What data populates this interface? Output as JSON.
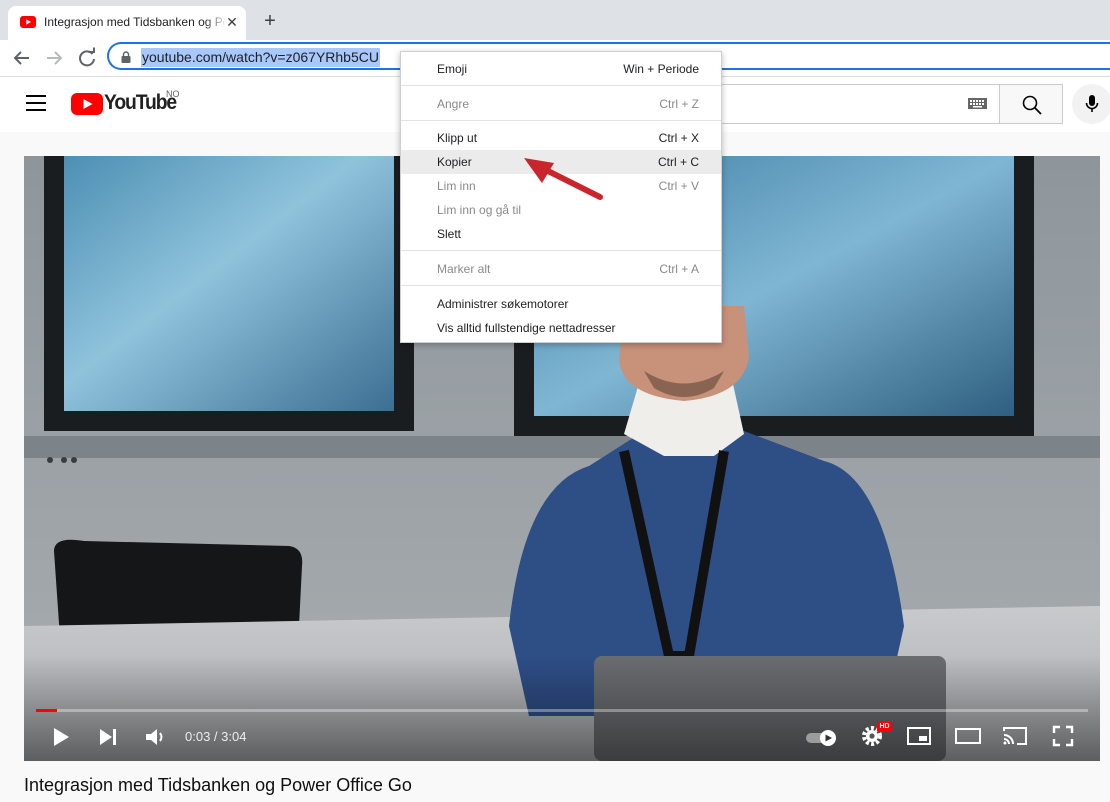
{
  "browser": {
    "tab_title": "Integrasjon med Tidsbanken og Power Office Go",
    "url": "youtube.com/watch?v=z067YRhb5CU"
  },
  "youtube": {
    "wordmark": "YouTube",
    "country_code": "NO"
  },
  "video": {
    "time": "0:03 / 3:04",
    "progress": 0.016,
    "title": "Integrasjon med Tidsbanken og Power Office Go",
    "quality_badge": "HD"
  },
  "context_menu": {
    "emoji": {
      "label": "Emoji",
      "shortcut": "Win + Periode"
    },
    "undo": {
      "label": "Angre",
      "shortcut": "Ctrl + Z"
    },
    "cut": {
      "label": "Klipp ut",
      "shortcut": "Ctrl + X"
    },
    "copy": {
      "label": "Kopier",
      "shortcut": "Ctrl + C"
    },
    "paste": {
      "label": "Lim inn",
      "shortcut": "Ctrl + V"
    },
    "paste_go": {
      "label": "Lim inn og gå til"
    },
    "delete": {
      "label": "Slett"
    },
    "select_all": {
      "label": "Marker alt",
      "shortcut": "Ctrl + A"
    },
    "manage_search": {
      "label": "Administrer søkemotorer"
    },
    "show_full_urls": {
      "label": "Vis alltid fullstendige nettadresser"
    }
  },
  "colors": {
    "youtube_red": "#ff0000",
    "focus_blue": "#1a73e8",
    "selection": "#a8c7fa",
    "annotation_arrow": "#c9252c"
  }
}
